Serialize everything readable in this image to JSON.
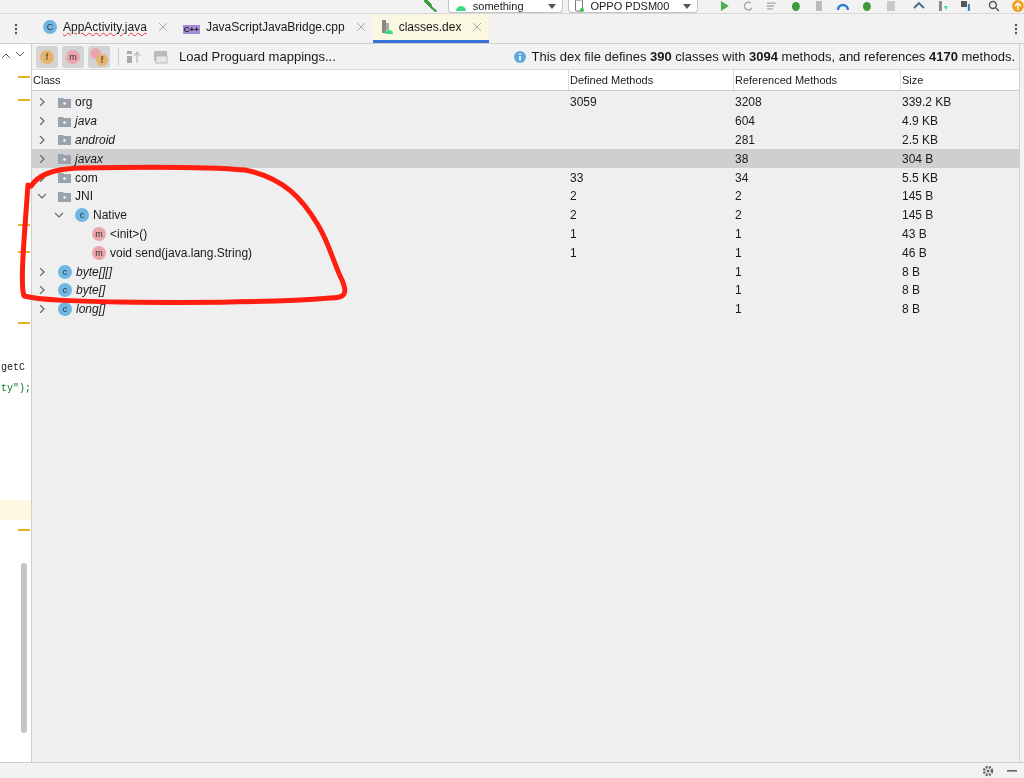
{
  "toolbar": {
    "run_configuration": "something",
    "device": "OPPO PDSM00"
  },
  "tabs": [
    {
      "label": "AppActivity.java",
      "kind": "class",
      "badge": "C",
      "error": true,
      "selected": false
    },
    {
      "label": "JavaScriptJavaBridge.cpp",
      "kind": "cpp",
      "badge": "C++",
      "error": false,
      "selected": false
    },
    {
      "label": "classes.dex",
      "kind": "dex",
      "error": false,
      "selected": true
    }
  ],
  "dex_toolbar": {
    "filter_buttons": [
      {
        "kind": "field",
        "badge": "f",
        "pressed": true
      },
      {
        "kind": "method",
        "badge": "m",
        "pressed": true
      },
      {
        "kind": "field-method",
        "badge": "f",
        "pressed": true
      }
    ],
    "mappings_label": "Load Proguard mappings...",
    "info": "This dex file defines **390** classes with **3094** methods, and references **4170** methods."
  },
  "table": {
    "columns": [
      "Class",
      "Defined Methods",
      "Referenced Methods",
      "Size"
    ],
    "rows": [
      {
        "name": "org",
        "kind": "package",
        "italic": false,
        "expanded": false,
        "selected": false,
        "defined": "3059",
        "referenced": "3208",
        "size": "339.2 KB"
      },
      {
        "name": "java",
        "kind": "package",
        "italic": true,
        "expanded": false,
        "selected": false,
        "referenced": "604",
        "size": "4.9 KB"
      },
      {
        "name": "android",
        "kind": "package",
        "italic": true,
        "expanded": false,
        "selected": false,
        "referenced": "281",
        "size": "2.5 KB"
      },
      {
        "name": "javax",
        "kind": "package",
        "italic": true,
        "expanded": false,
        "selected": true,
        "referenced": "38",
        "size": "304 B"
      },
      {
        "name": "com",
        "kind": "package",
        "italic": false,
        "expanded": false,
        "selected": false,
        "defined": "33",
        "referenced": "34",
        "size": "5.5 KB"
      },
      {
        "name": "JNI",
        "kind": "package",
        "italic": false,
        "expanded": true,
        "selected": false,
        "defined": "2",
        "referenced": "2",
        "size": "145 B",
        "children": [
          {
            "name": "Native",
            "kind": "class",
            "badge": "c",
            "italic": false,
            "expanded": true,
            "selected": false,
            "defined": "2",
            "referenced": "2",
            "size": "145 B",
            "children": [
              {
                "name": "<init>()",
                "kind": "method",
                "badge": "m",
                "italic": false,
                "selected": false,
                "defined": "1",
                "referenced": "1",
                "size": "43 B"
              },
              {
                "name": "void send(java.lang.String)",
                "kind": "method",
                "badge": "m",
                "italic": false,
                "selected": false,
                "defined": "1",
                "referenced": "1",
                "size": "46 B"
              }
            ]
          }
        ]
      },
      {
        "name": "byte[][]",
        "kind": "class",
        "badge": "c",
        "italic": true,
        "expanded": false,
        "selected": false,
        "referenced": "1",
        "size": "8 B"
      },
      {
        "name": "byte[]",
        "kind": "class",
        "badge": "c",
        "italic": true,
        "expanded": false,
        "selected": false,
        "referenced": "1",
        "size": "8 B"
      },
      {
        "name": "long[]",
        "kind": "class",
        "badge": "c",
        "italic": true,
        "expanded": false,
        "selected": false,
        "referenced": "1",
        "size": "8 B"
      }
    ]
  },
  "editor_gutter": {
    "code_lines": [
      {
        "text": "getC",
        "kind": "plain"
      },
      {
        "text": "ty\");",
        "kind": "string"
      }
    ]
  },
  "annotation": {
    "kind": "freehand-loop",
    "color": "#ff1e0f"
  }
}
